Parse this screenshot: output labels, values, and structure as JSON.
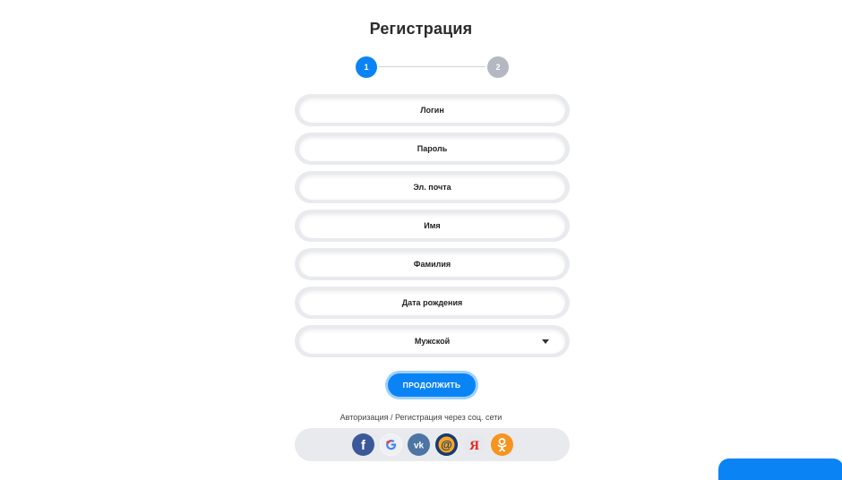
{
  "page": {
    "title": "Регистрация"
  },
  "steps": {
    "step1": "1",
    "step2": "2"
  },
  "form": {
    "login_placeholder": "Логин",
    "password_placeholder": "Пароль",
    "email_placeholder": "Эл. почта",
    "first_name_placeholder": "Имя",
    "last_name_placeholder": "Фамилия",
    "birthdate_placeholder": "Дата рождения",
    "gender_value": "Мужской"
  },
  "actions": {
    "continue_label": "ПРОДОЛЖИТЬ"
  },
  "social": {
    "text": "Авторизация / Регистрация через соц. сети",
    "icons": [
      "facebook-icon",
      "google-icon",
      "vk-icon",
      "mail-ru-icon",
      "yandex-icon",
      "odnoklassniki-icon"
    ]
  },
  "colors": {
    "accent": "#0a84f5",
    "step_inactive": "#b4b8c3",
    "field_bg": "#e8eaee"
  }
}
